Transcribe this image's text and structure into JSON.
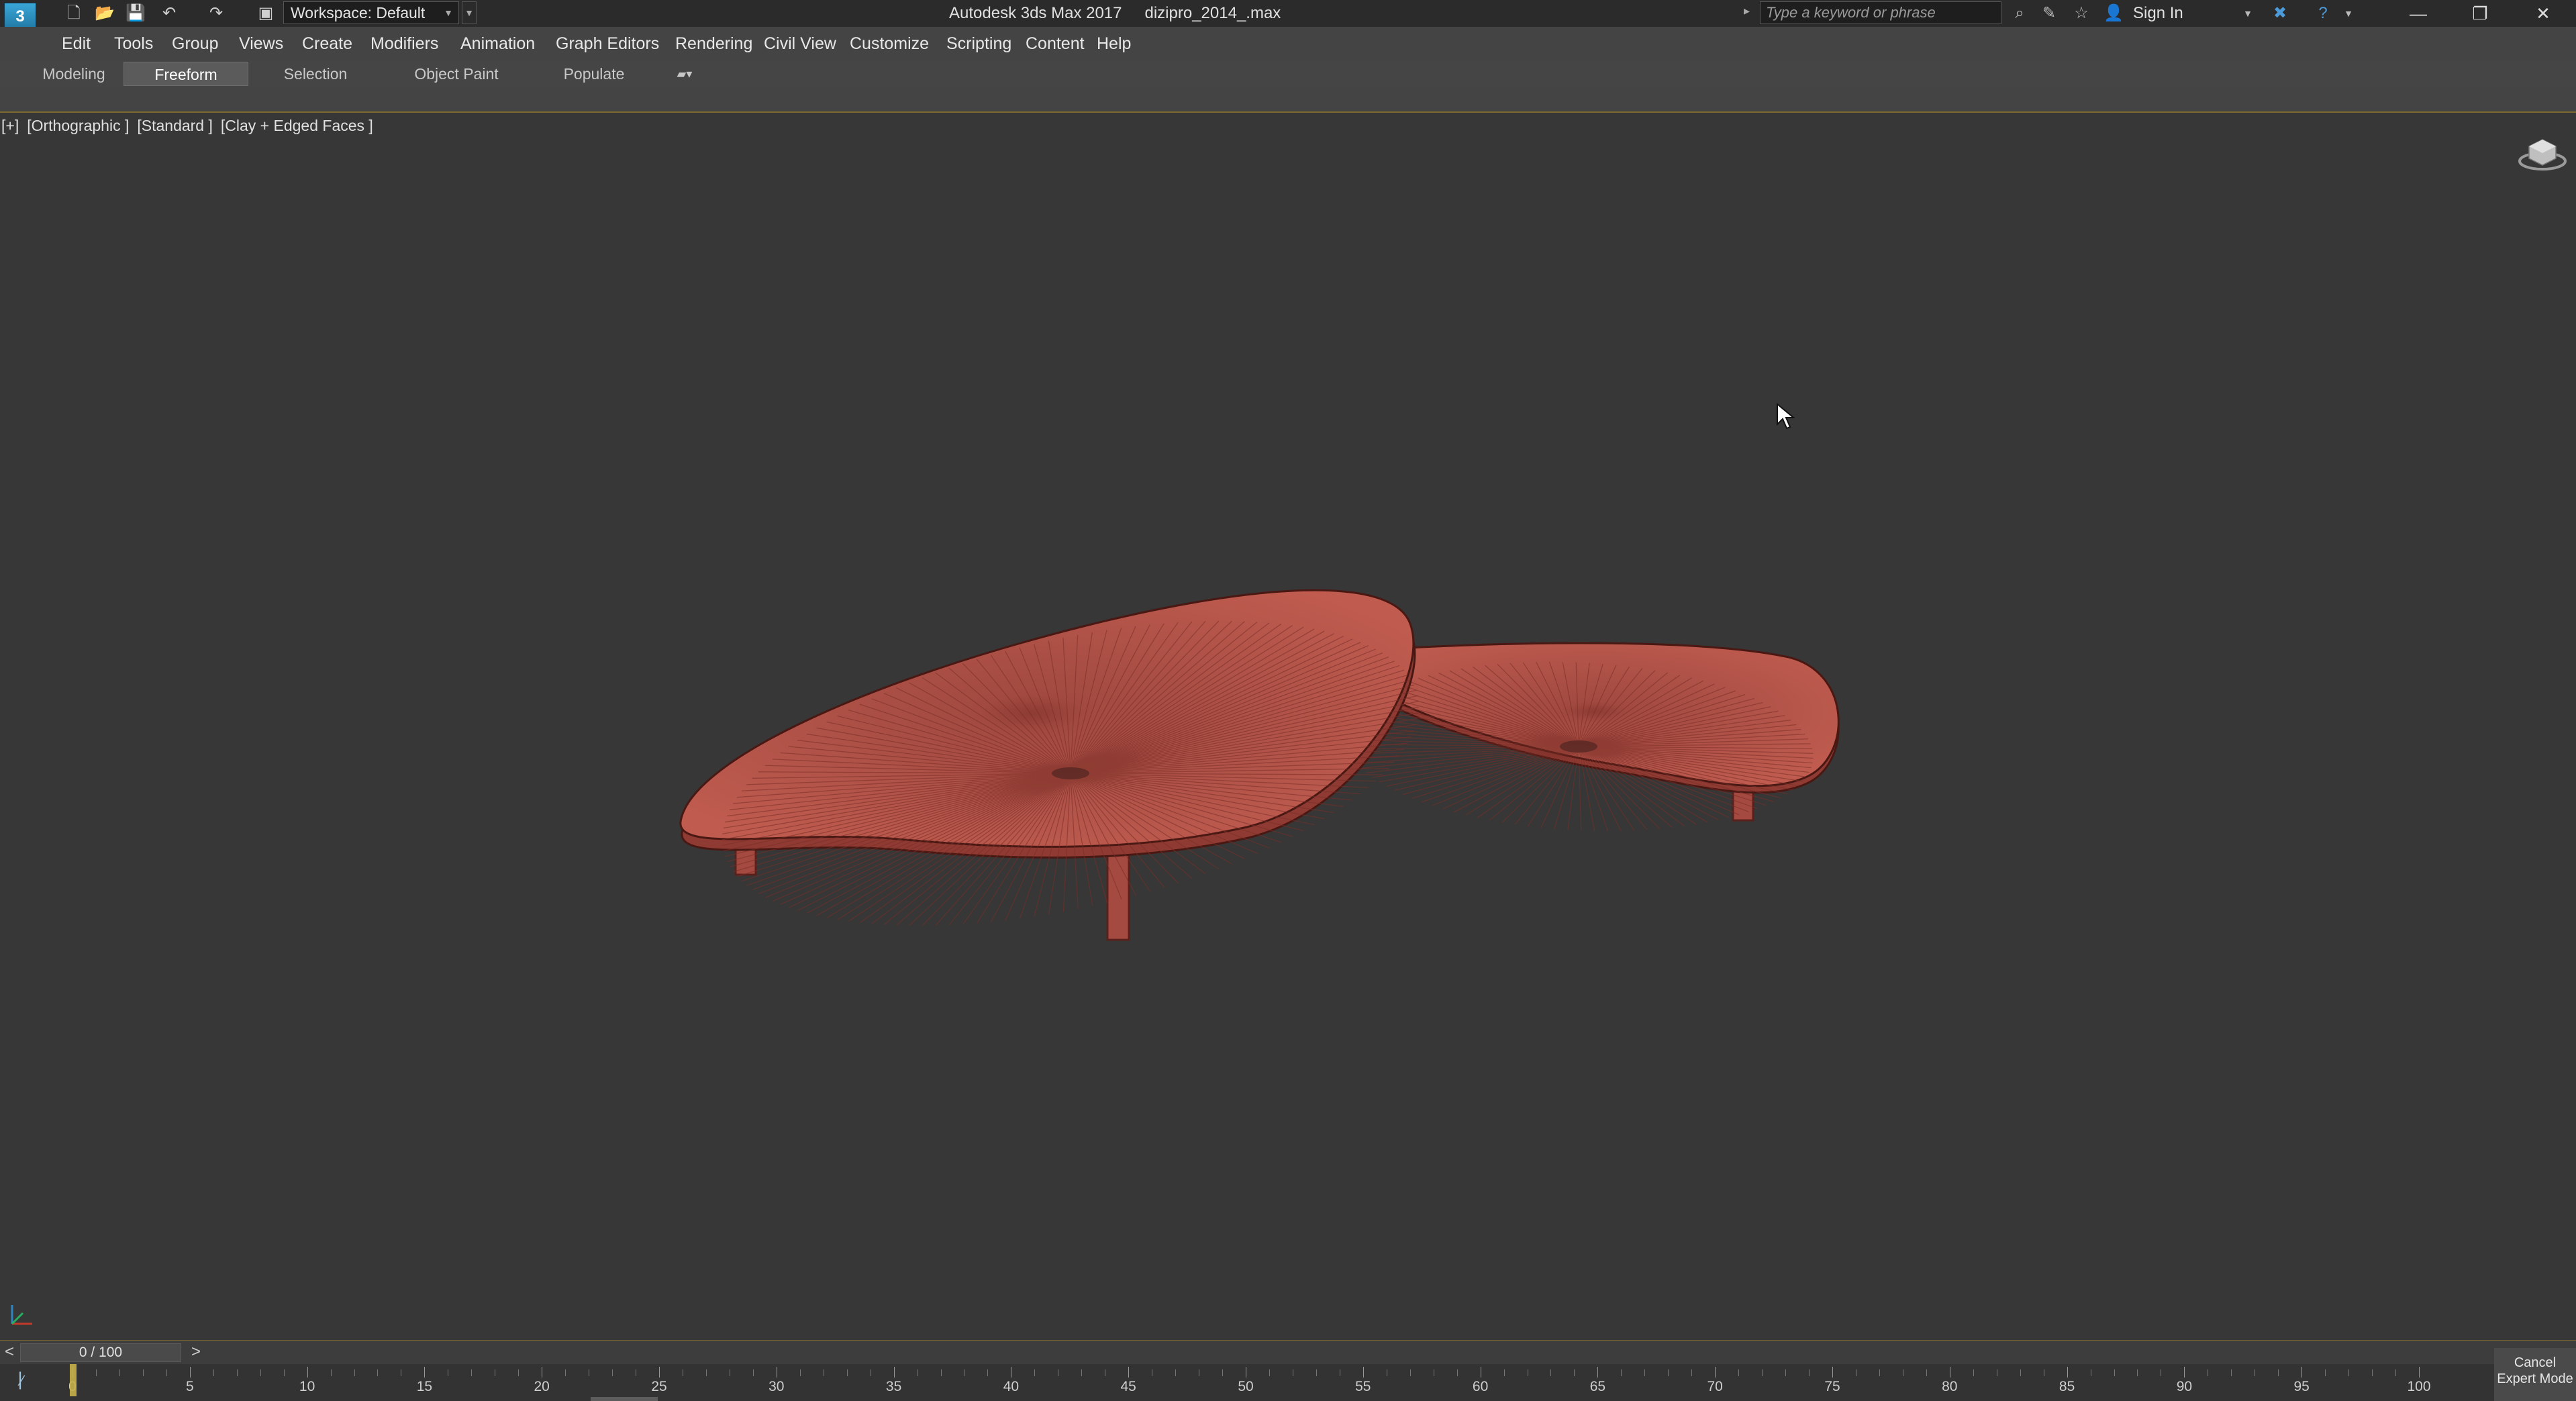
{
  "window": {
    "app_name": "Autodesk 3ds Max 2017",
    "file_name": "dizipro_2014_.max",
    "minimize": "—",
    "restore": "❐",
    "close": "✕"
  },
  "quick_access": {
    "workspace_label": "Workspace: Default",
    "search_placeholder": "Type a keyword or phrase",
    "sign_in": "Sign In"
  },
  "menu": [
    "Edit",
    "Tools",
    "Group",
    "Views",
    "Create",
    "Modifiers",
    "Animation",
    "Graph Editors",
    "Rendering",
    "Civil View",
    "Customize",
    "Scripting",
    "Content",
    "Help"
  ],
  "ribbon_tabs": [
    {
      "label": "Modeling",
      "active": false
    },
    {
      "label": "Freeform",
      "active": true
    },
    {
      "label": "Selection",
      "active": false
    },
    {
      "label": "Object Paint",
      "active": false
    },
    {
      "label": "Populate",
      "active": false
    }
  ],
  "viewport": {
    "labels": [
      "[+]",
      "[Orthographic ]",
      "[Standard ]",
      "[Clay + Edged Faces ]"
    ],
    "object_color": "#b8574c",
    "background_color": "#373737"
  },
  "timeline": {
    "frame_display": "0 / 100",
    "prev": "<",
    "next": ">",
    "ticks": [
      "0",
      "5",
      "10",
      "15",
      "20",
      "25",
      "30",
      "35",
      "40",
      "45",
      "50",
      "55",
      "60",
      "65",
      "70",
      "75",
      "80",
      "85",
      "90",
      "95",
      "100"
    ]
  },
  "cancel_expert": {
    "line1": "Cancel",
    "line2": "Expert Mode"
  }
}
